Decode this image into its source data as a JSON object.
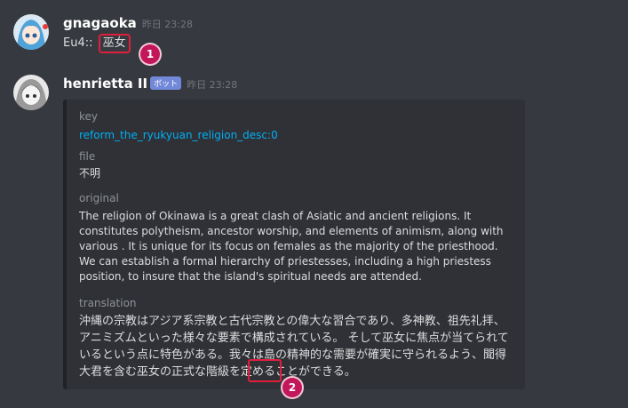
{
  "messages": [
    {
      "username": "gnagaoka",
      "timestamp": "昨日 23:28",
      "text_prefix": "Eu4::",
      "text_highlight": "巫女"
    },
    {
      "username": "henrietta II",
      "badge": "ボット",
      "timestamp": "昨日 23:28"
    }
  ],
  "embed": {
    "fields": [
      {
        "name": "key",
        "value": "reform_the_ryukyuan_religion_desc:0"
      },
      {
        "name": "file",
        "value": "不明"
      },
      {
        "name": "original",
        "value": "The religion of Okinawa is a great clash of Asiatic and ancient religions. It constitutes polytheism, ancestor worship, and elements of animism, along with various . It is unique for its focus on females as the majority of the priesthood. We can establish a formal hierarchy of priestesses, including a high priestess position, to insure that the island's spiritual needs are attended."
      },
      {
        "name": "translation",
        "value": "沖縄の宗教はアジア系宗教と古代宗教との偉大な習合であり、多神教、祖先礼拝、アニミズムといった様々な要素で構成されている。 そして巫女に焦点が当てられているという点に特色がある。我々は島の精神的な需要が確実に守られるよう、聞得大君を含む巫女の正式な階級を定めることができる。"
      }
    ]
  },
  "annotations": [
    "1",
    "2"
  ]
}
